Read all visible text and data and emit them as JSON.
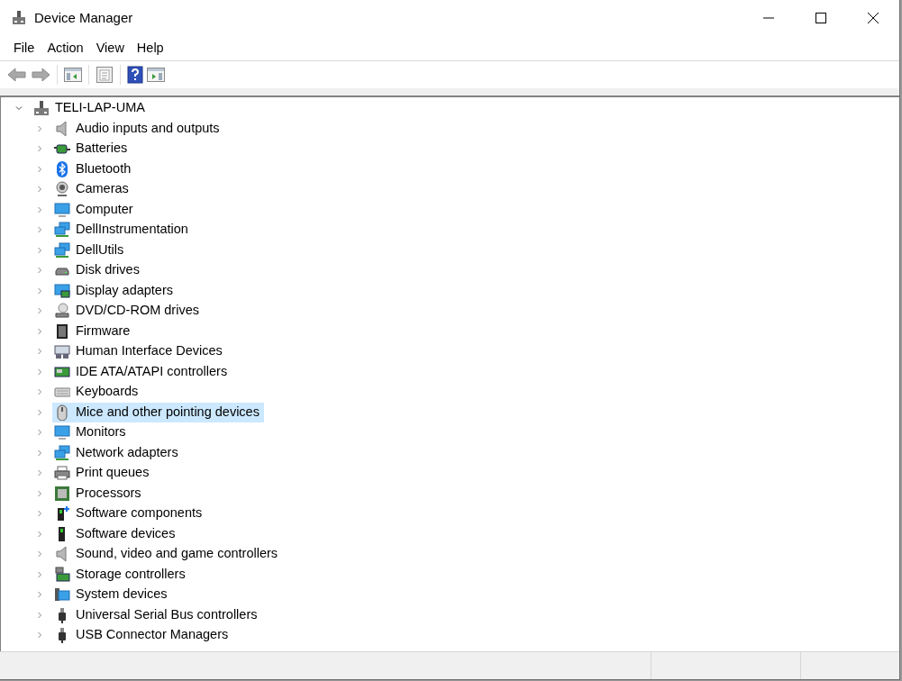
{
  "window": {
    "title": "Device Manager"
  },
  "menu": [
    "File",
    "Action",
    "View",
    "Help"
  ],
  "tree": {
    "label": "TELI-LAP-UMA",
    "expanded": true,
    "selected": false,
    "children": [
      {
        "label": "Audio inputs and outputs",
        "expanded": false,
        "selected": false
      },
      {
        "label": "Batteries",
        "expanded": false,
        "selected": false
      },
      {
        "label": "Bluetooth",
        "expanded": false,
        "selected": false
      },
      {
        "label": "Cameras",
        "expanded": false,
        "selected": false
      },
      {
        "label": "Computer",
        "expanded": false,
        "selected": false
      },
      {
        "label": "DellInstrumentation",
        "expanded": false,
        "selected": false
      },
      {
        "label": "DellUtils",
        "expanded": false,
        "selected": false
      },
      {
        "label": "Disk drives",
        "expanded": false,
        "selected": false
      },
      {
        "label": "Display adapters",
        "expanded": false,
        "selected": false
      },
      {
        "label": "DVD/CD-ROM drives",
        "expanded": false,
        "selected": false
      },
      {
        "label": "Firmware",
        "expanded": false,
        "selected": false
      },
      {
        "label": "Human Interface Devices",
        "expanded": false,
        "selected": false
      },
      {
        "label": "IDE ATA/ATAPI controllers",
        "expanded": false,
        "selected": false
      },
      {
        "label": "Keyboards",
        "expanded": false,
        "selected": false
      },
      {
        "label": "Mice and other pointing devices",
        "expanded": false,
        "selected": true
      },
      {
        "label": "Monitors",
        "expanded": false,
        "selected": false
      },
      {
        "label": "Network adapters",
        "expanded": false,
        "selected": false
      },
      {
        "label": "Print queues",
        "expanded": false,
        "selected": false
      },
      {
        "label": "Processors",
        "expanded": false,
        "selected": false
      },
      {
        "label": "Software components",
        "expanded": false,
        "selected": false
      },
      {
        "label": "Software devices",
        "expanded": false,
        "selected": false
      },
      {
        "label": "Sound, video and game controllers",
        "expanded": false,
        "selected": false
      },
      {
        "label": "Storage controllers",
        "expanded": false,
        "selected": false
      },
      {
        "label": "System devices",
        "expanded": false,
        "selected": false
      },
      {
        "label": "Universal Serial Bus controllers",
        "expanded": false,
        "selected": false
      },
      {
        "label": "USB Connector Managers",
        "expanded": false,
        "selected": false
      }
    ]
  }
}
